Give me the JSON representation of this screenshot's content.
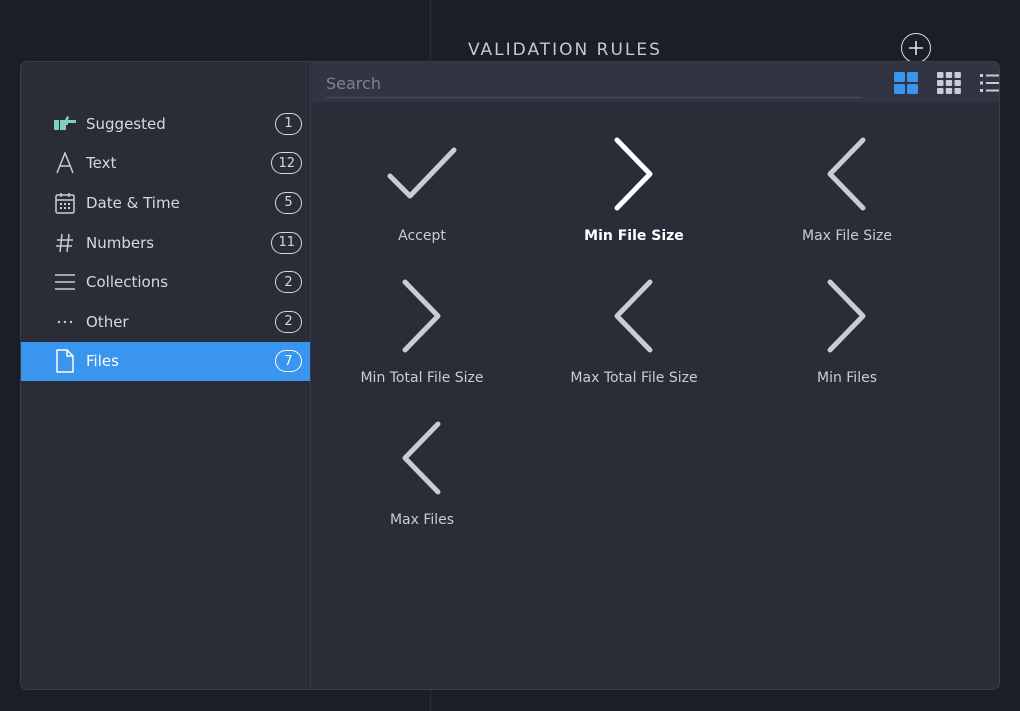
{
  "background": {
    "title": "VALIDATION RULES",
    "add_icon": "plus-circle-icon"
  },
  "colors": {
    "accent": "#3a95ee",
    "panel": "#2a2d38",
    "page_bg": "#1b1d27",
    "suggested_icon": "#7fd0c0"
  },
  "sidebar": {
    "items": [
      {
        "label": "Suggested",
        "count": "1",
        "icon": "pointing-hand-icon",
        "active": false
      },
      {
        "label": "Text",
        "count": "12",
        "icon": "text-a-icon",
        "active": false
      },
      {
        "label": "Date & Time",
        "count": "5",
        "icon": "calendar-icon",
        "active": false
      },
      {
        "label": "Numbers",
        "count": "11",
        "icon": "hash-icon",
        "active": false
      },
      {
        "label": "Collections",
        "count": "2",
        "icon": "list-lines-icon",
        "active": false
      },
      {
        "label": "Other",
        "count": "2",
        "icon": "ellipsis-icon",
        "active": false
      },
      {
        "label": "Files",
        "count": "7",
        "icon": "file-icon",
        "active": true
      }
    ]
  },
  "toolbar": {
    "search_placeholder": "Search",
    "search_value": "",
    "views": [
      "large-grid-icon",
      "small-grid-icon",
      "list-view-icon"
    ],
    "active_view": "large-grid-icon"
  },
  "rules": [
    {
      "label": "Accept",
      "icon": "checkmark-icon"
    },
    {
      "label": "Min File Size",
      "icon": "greater-than-icon",
      "highlighted": true
    },
    {
      "label": "Max File Size",
      "icon": "less-than-icon"
    },
    {
      "label": "Min Total File Size",
      "icon": "greater-than-icon"
    },
    {
      "label": "Max Total File Size",
      "icon": "less-than-icon"
    },
    {
      "label": "Min Files",
      "icon": "greater-than-icon"
    },
    {
      "label": "Max Files",
      "icon": "less-than-icon"
    }
  ]
}
